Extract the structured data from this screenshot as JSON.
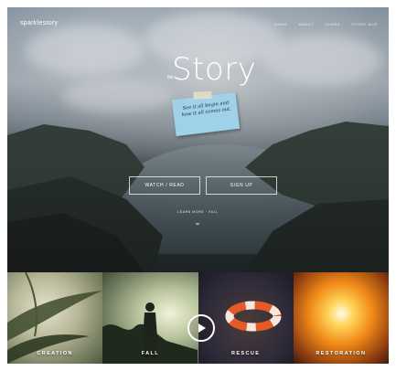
{
  "header": {
    "logo_text": "sparklestory",
    "nav": [
      "HOME",
      "ABOUT",
      "SHARE",
      "STORY MAP"
    ]
  },
  "hero": {
    "pre_title": "the",
    "title": "Story",
    "note_text": "See it all begin and how it all comes out.",
    "buttons": {
      "watch": "WATCH / READ",
      "signup": "SIGN UP"
    },
    "learn_more": "LEARN MORE · FALL",
    "chevron": "⌄"
  },
  "panels": [
    "CREATION",
    "FALL",
    "RESCUE",
    "RESTORATION"
  ],
  "icons": {
    "play": "play-icon",
    "chevron": "chevron-down-icon"
  },
  "colors": {
    "note": "#9fd1e8",
    "button_border": "#ffffff"
  }
}
